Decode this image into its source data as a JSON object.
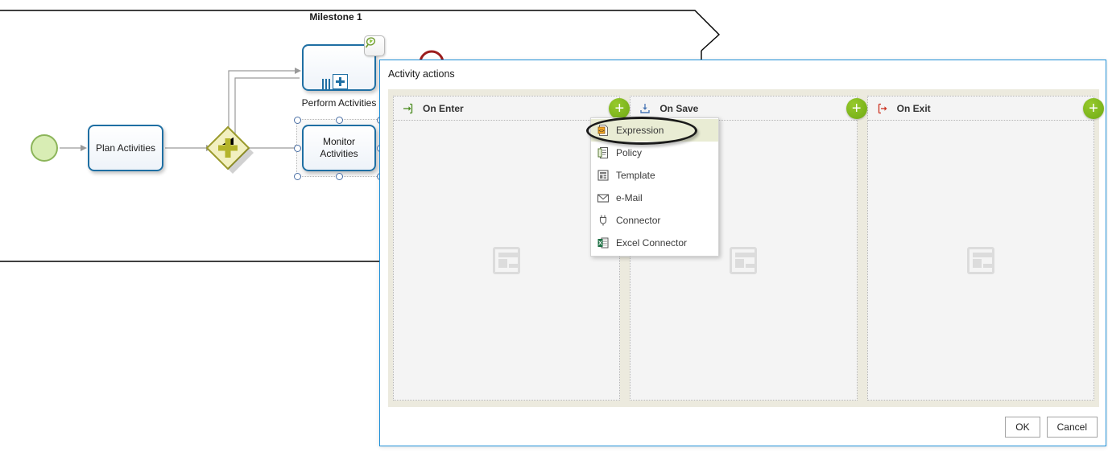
{
  "canvas": {
    "milestone_label": "Milestone 1",
    "nodes": {
      "start_event": "start-event",
      "plan": "Plan Activities",
      "gateway": "parallel-gateway",
      "perform": "Perform Activities",
      "monitor_line1": "Monitor",
      "monitor_line2": "Activities"
    },
    "icons": {
      "drill_down": "drill-down-magnifier-icon",
      "sub_process": "sub-process-plus-icon",
      "parallel_bars": "parallel-multi-instance-icon"
    },
    "colors": {
      "task_border": "#1f6fa3",
      "start_event": "#cfe6a4",
      "gateway": "#b4b43c",
      "milestone_line": "#000000"
    }
  },
  "dialog": {
    "title": "Activity actions",
    "panels": [
      {
        "id": "on-enter",
        "label": "On Enter",
        "icon": "enter-arrow-icon",
        "icon_color": "#4b8b1f",
        "add_label": "+"
      },
      {
        "id": "on-save",
        "label": "On Save",
        "icon": "save-download-icon",
        "icon_color": "#4a77b5",
        "add_label": "+"
      },
      {
        "id": "on-exit",
        "label": "On Exit",
        "icon": "exit-arrow-icon",
        "icon_color": "#cc3322",
        "add_label": "+"
      }
    ],
    "placeholder_icon": "empty-content-placeholder-icon",
    "buttons": {
      "ok": "OK",
      "cancel": "Cancel"
    },
    "accent": "#1e90d8",
    "add_button_color": "#7cb518"
  },
  "context_menu": {
    "items": [
      {
        "label": "Expression",
        "icon": "expression-code-icon",
        "selected": true
      },
      {
        "label": "Policy",
        "icon": "policy-document-icon",
        "selected": false
      },
      {
        "label": "Template",
        "icon": "template-layout-icon",
        "selected": false
      },
      {
        "label": "e-Mail",
        "icon": "envelope-icon",
        "selected": false
      },
      {
        "label": "Connector",
        "icon": "connector-plug-icon",
        "selected": false
      },
      {
        "label": "Excel Connector",
        "icon": "excel-connector-icon",
        "selected": false
      }
    ],
    "highlight_color": "#e9ecd4"
  },
  "annotation": {
    "shape": "ellipse-highlight",
    "target": "Expression"
  }
}
